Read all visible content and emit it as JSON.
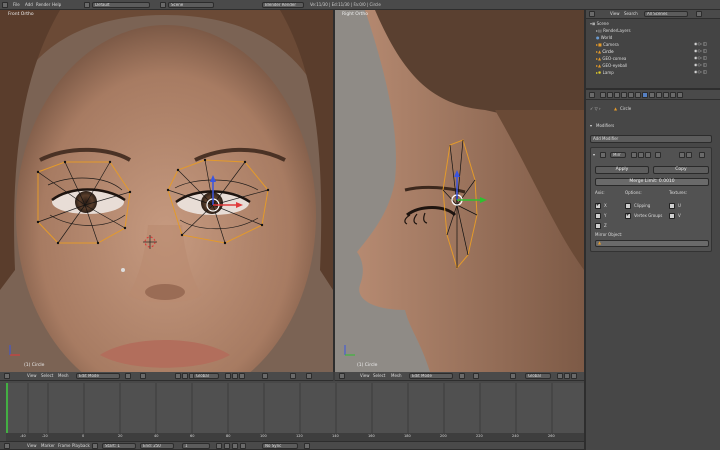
{
  "topbar": {
    "menus": [
      "File",
      "Add",
      "Render",
      "Help"
    ],
    "layout": "Default",
    "scene": "Scene",
    "engine": "Blender Render",
    "stats": "Ve:11/30 | Ed:11/30 | Fa:0/0 | Circle"
  },
  "viewport_left": {
    "label": "Front Ortho",
    "object_label": "(1) Circle"
  },
  "viewport_right": {
    "label": "Right Ortho",
    "object_label": "(1) Circle"
  },
  "viewport_header": {
    "menus": [
      "View",
      "Select",
      "Mesh"
    ],
    "mode": "Edit Mode",
    "orientation": "Global"
  },
  "timeline": {
    "ticks": [
      "-40",
      "-20",
      "0",
      "20",
      "40",
      "60",
      "80",
      "100",
      "120",
      "140",
      "160",
      "180",
      "200",
      "220",
      "240",
      "260"
    ],
    "menus": [
      "View",
      "Marker",
      "Frame",
      "Playback"
    ],
    "start": "Start: 1",
    "end": "End: 250",
    "current": "1",
    "sync": "No Sync"
  },
  "outliner": {
    "header": [
      "View",
      "Search"
    ],
    "filter": "All Scenes",
    "items": [
      "Scene",
      "RenderLayers",
      "World",
      "Camera",
      "Circle",
      "GEO-cornea",
      "GEO-eyeball",
      "Lamp"
    ]
  },
  "properties": {
    "breadcrumb": "Circle",
    "section": "Modifiers",
    "add_modifier": "Add Modifier",
    "modifier_name": "Mirr",
    "apply": "Apply",
    "copy": "Copy",
    "merge_limit": "Merge Limit: 0.0010",
    "axis_label": "Axis:",
    "options_label": "Options:",
    "textures_label": "Textures:",
    "axis": [
      "X",
      "Y",
      "Z"
    ],
    "options": [
      "Clipping",
      "Vertex Groups"
    ],
    "textures": [
      "U",
      "V"
    ],
    "mirror_object": "Mirror Object:"
  }
}
